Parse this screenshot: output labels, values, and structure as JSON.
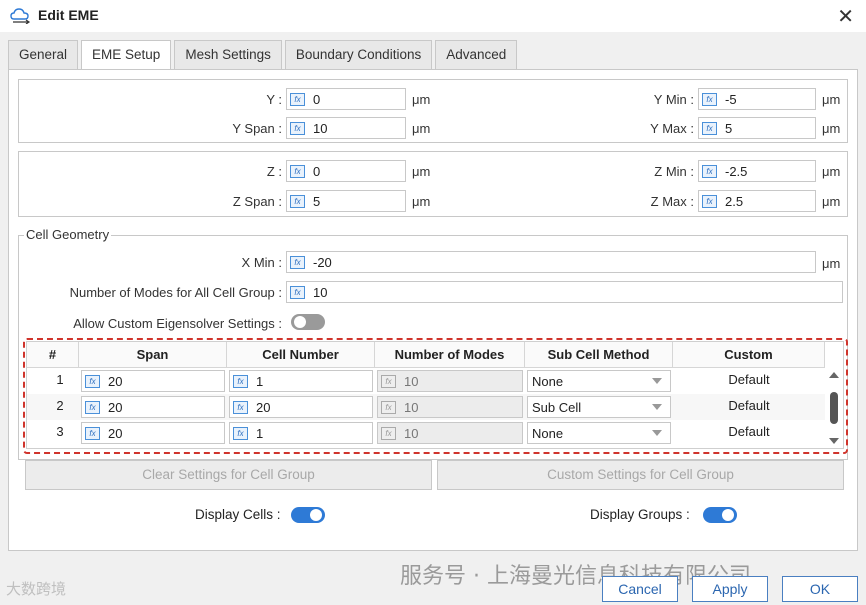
{
  "window": {
    "title": "Edit EME"
  },
  "tabs": [
    {
      "label": "General"
    },
    {
      "label": "EME Setup"
    },
    {
      "label": "Mesh Settings"
    },
    {
      "label": "Boundary Conditions"
    },
    {
      "label": "Advanced"
    }
  ],
  "active_tab": "EME Setup",
  "y_group": {
    "y": {
      "label": "Y :",
      "value": "0",
      "unit": "μm"
    },
    "y_span": {
      "label": "Y Span :",
      "value": "10",
      "unit": "μm"
    },
    "y_min": {
      "label": "Y Min :",
      "value": "-5",
      "unit": "μm"
    },
    "y_max": {
      "label": "Y Max :",
      "value": "5",
      "unit": "μm"
    }
  },
  "z_group": {
    "z": {
      "label": "Z :",
      "value": "0",
      "unit": "μm"
    },
    "z_span": {
      "label": "Z Span :",
      "value": "5",
      "unit": "μm"
    },
    "z_min": {
      "label": "Z Min :",
      "value": "-2.5",
      "unit": "μm"
    },
    "z_max": {
      "label": "Z Max :",
      "value": "2.5",
      "unit": "μm"
    }
  },
  "cell_geometry": {
    "title": "Cell Geometry",
    "x_min": {
      "label": "X Min :",
      "value": "-20",
      "unit": "μm"
    },
    "num_modes": {
      "label": "Number of Modes for All Cell Group :",
      "value": "10"
    },
    "allow_custom": {
      "label": "Allow Custom Eigensolver Settings :",
      "enabled": false
    }
  },
  "cell_table": {
    "headers": [
      "#",
      "Span",
      "Cell Number",
      "Number of Modes",
      "Sub Cell Method",
      "Custom"
    ],
    "rows": [
      {
        "num": "1",
        "span": "20",
        "cell_number": "1",
        "modes": "10",
        "method": "None",
        "custom": "Default"
      },
      {
        "num": "2",
        "span": "20",
        "cell_number": "20",
        "modes": "10",
        "method": "Sub Cell",
        "custom": "Default"
      },
      {
        "num": "3",
        "span": "20",
        "cell_number": "1",
        "modes": "10",
        "method": "None",
        "custom": "Default"
      }
    ]
  },
  "buttons": {
    "clear_settings": "Clear Settings for Cell Group",
    "custom_settings": "Custom Settings for Cell Group",
    "cancel": "Cancel",
    "apply": "Apply",
    "ok": "OK"
  },
  "display": {
    "cells_label": "Display Cells :",
    "cells_on": true,
    "groups_label": "Display Groups :",
    "groups_on": true
  },
  "watermark": {
    "text": "服务号 · 上海曼光信息科技有限公司",
    "corner": "大数跨境"
  },
  "colors": {
    "accent": "#2e7ad6",
    "highlight_border": "#d0342c"
  }
}
